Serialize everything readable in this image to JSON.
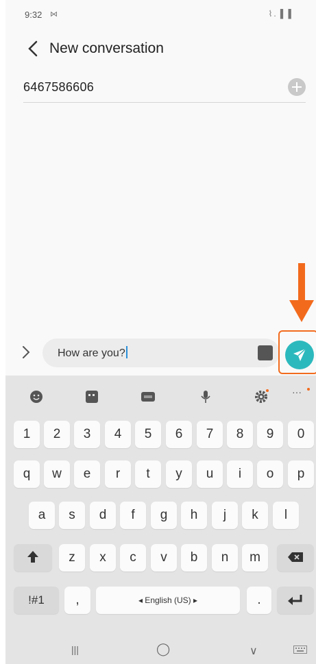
{
  "status_bar": {
    "time": "9:32",
    "notification": "⋈",
    "icons": "⌇.▐ ▌"
  },
  "header": {
    "title": "New conversation"
  },
  "recipient": {
    "value": "6467586606"
  },
  "compose": {
    "text": "How are you?"
  },
  "colors": {
    "accent": "#2cb9bd",
    "annotation": "#f26b1d"
  },
  "keyboard": {
    "number_row": [
      "1",
      "2",
      "3",
      "4",
      "5",
      "6",
      "7",
      "8",
      "9",
      "0"
    ],
    "row1": [
      "q",
      "w",
      "e",
      "r",
      "t",
      "y",
      "u",
      "i",
      "o",
      "p"
    ],
    "row2": [
      "a",
      "s",
      "d",
      "f",
      "g",
      "h",
      "j",
      "k",
      "l"
    ],
    "row3": [
      "z",
      "x",
      "c",
      "v",
      "b",
      "n",
      "m"
    ],
    "symbols_label": "!#1",
    "comma_label": ",",
    "space_label": "◂ English (US) ▸",
    "period_label": ".",
    "toolbar_more": "···",
    "toolbar_icons": [
      "emoji-icon",
      "sticker-icon",
      "gif-icon",
      "microphone-icon",
      "settings-icon",
      "more-icon"
    ]
  },
  "nav_bar": {
    "recents": "|||",
    "home": "◯",
    "back": "∨",
    "keyboard_icon": "keyboard-icon"
  }
}
